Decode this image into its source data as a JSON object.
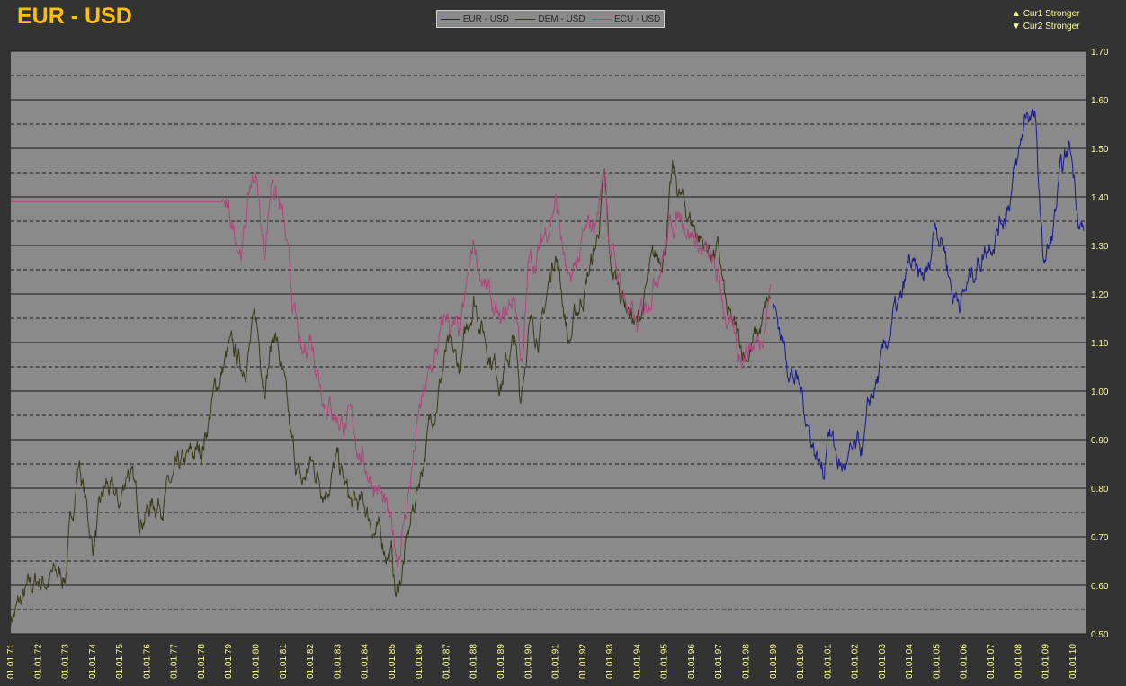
{
  "title": "EUR - USD",
  "legend": [
    {
      "label": "EUR - USD",
      "color": "#1a1a8c"
    },
    {
      "label": "DEM - USD",
      "color": "#3a3a1a"
    },
    {
      "label": "ECU - USD",
      "color": "#b0457a"
    }
  ],
  "strength_legend": {
    "up_symbol": "▲",
    "up_label": "Cur1 Stronger",
    "down_symbol": "▼",
    "down_label": "Cur2 Stronger"
  },
  "chart_data": {
    "type": "line",
    "title": "EUR - USD",
    "ylim": [
      0.5,
      1.7
    ],
    "y_ticks": [
      "0.50",
      "0.60",
      "0.70",
      "0.80",
      "0.90",
      "1.00",
      "1.10",
      "1.20",
      "1.30",
      "1.40",
      "1.50",
      "1.60",
      "1.70"
    ],
    "x_range": [
      1971,
      2010.5
    ],
    "x_ticks": [
      "01.01.71",
      "01.01.72",
      "01.01.73",
      "01.01.74",
      "01.01.75",
      "01.01.76",
      "01.01.77",
      "01.01.78",
      "01.01.79",
      "01.01.80",
      "01.01.81",
      "01.01.82",
      "01.01.83",
      "01.01.84",
      "01.01.85",
      "01.01.86",
      "01.01.87",
      "01.01.88",
      "01.01.89",
      "01.01.90",
      "01.01.91",
      "01.01.92",
      "01.01.93",
      "01.01.94",
      "01.01.95",
      "01.01.96",
      "01.01.97",
      "01.01.98",
      "01.01.99",
      "01.01.00",
      "01.01.01",
      "01.01.02",
      "01.01.03",
      "01.01.04",
      "01.01.05",
      "01.01.06",
      "01.01.07",
      "01.01.08",
      "01.01.09",
      "01.01.10"
    ],
    "grid": "horizontal solid major, dashed minor",
    "series": [
      {
        "name": "DEM - USD",
        "color": "#3a3a1a",
        "points": [
          [
            1971.0,
            0.535
          ],
          [
            1971.5,
            0.57
          ],
          [
            1972.0,
            0.61
          ],
          [
            1972.5,
            0.615
          ],
          [
            1973.0,
            0.625
          ],
          [
            1973.2,
            0.72
          ],
          [
            1973.5,
            0.86
          ],
          [
            1974.0,
            0.68
          ],
          [
            1974.5,
            0.8
          ],
          [
            1975.0,
            0.76
          ],
          [
            1975.3,
            0.85
          ],
          [
            1975.7,
            0.75
          ],
          [
            1976.0,
            0.76
          ],
          [
            1976.5,
            0.78
          ],
          [
            1977.0,
            0.81
          ],
          [
            1977.5,
            0.85
          ],
          [
            1978.0,
            0.88
          ],
          [
            1978.5,
            1.0
          ],
          [
            1979.0,
            1.08
          ],
          [
            1979.5,
            1.05
          ],
          [
            1980.0,
            1.14
          ],
          [
            1980.3,
            1.03
          ],
          [
            1980.7,
            1.13
          ],
          [
            1981.0,
            1.02
          ],
          [
            1981.3,
            0.88
          ],
          [
            1981.7,
            0.8
          ],
          [
            1982.0,
            0.85
          ],
          [
            1982.5,
            0.81
          ],
          [
            1983.0,
            0.85
          ],
          [
            1983.5,
            0.76
          ],
          [
            1984.0,
            0.76
          ],
          [
            1984.5,
            0.7
          ],
          [
            1985.0,
            0.66
          ],
          [
            1985.15,
            0.57
          ],
          [
            1985.5,
            0.67
          ],
          [
            1986.0,
            0.82
          ],
          [
            1986.5,
            0.96
          ],
          [
            1987.0,
            1.08
          ],
          [
            1987.5,
            1.04
          ],
          [
            1988.0,
            1.2
          ],
          [
            1988.5,
            1.1
          ],
          [
            1989.0,
            1.03
          ],
          [
            1989.5,
            1.1
          ],
          [
            1989.7,
            0.98
          ],
          [
            1990.0,
            1.13
          ],
          [
            1990.5,
            1.13
          ],
          [
            1991.0,
            1.3
          ],
          [
            1991.5,
            1.1
          ],
          [
            1992.0,
            1.2
          ],
          [
            1992.5,
            1.3
          ],
          [
            1992.8,
            1.43
          ],
          [
            1993.0,
            1.25
          ],
          [
            1993.5,
            1.2
          ],
          [
            1994.0,
            1.13
          ],
          [
            1994.5,
            1.24
          ],
          [
            1995.0,
            1.3
          ],
          [
            1995.3,
            1.44
          ],
          [
            1995.7,
            1.38
          ],
          [
            1996.0,
            1.35
          ],
          [
            1996.5,
            1.3
          ],
          [
            1997.0,
            1.28
          ],
          [
            1997.3,
            1.15
          ],
          [
            1997.7,
            1.1
          ],
          [
            1998.0,
            1.08
          ],
          [
            1998.5,
            1.12
          ],
          [
            1998.9,
            1.19
          ]
        ]
      },
      {
        "name": "ECU - USD",
        "color": "#b0457a",
        "points": [
          [
            1971.0,
            1.39
          ],
          [
            1978.8,
            1.39
          ],
          [
            1979.0,
            1.35
          ],
          [
            1979.5,
            1.3
          ],
          [
            1979.8,
            1.42
          ],
          [
            1980.0,
            1.45
          ],
          [
            1980.3,
            1.28
          ],
          [
            1980.6,
            1.45
          ],
          [
            1981.0,
            1.35
          ],
          [
            1981.3,
            1.2
          ],
          [
            1981.7,
            1.05
          ],
          [
            1982.0,
            1.12
          ],
          [
            1982.5,
            1.0
          ],
          [
            1983.0,
            0.95
          ],
          [
            1983.5,
            0.93
          ],
          [
            1984.0,
            0.85
          ],
          [
            1984.5,
            0.8
          ],
          [
            1985.0,
            0.7
          ],
          [
            1985.2,
            0.66
          ],
          [
            1985.5,
            0.75
          ],
          [
            1986.0,
            0.95
          ],
          [
            1986.5,
            1.05
          ],
          [
            1987.0,
            1.15
          ],
          [
            1987.5,
            1.1
          ],
          [
            1988.0,
            1.3
          ],
          [
            1988.5,
            1.2
          ],
          [
            1989.0,
            1.12
          ],
          [
            1989.5,
            1.2
          ],
          [
            1989.8,
            1.05
          ],
          [
            1990.0,
            1.25
          ],
          [
            1990.5,
            1.3
          ],
          [
            1991.0,
            1.4
          ],
          [
            1991.5,
            1.2
          ],
          [
            1992.0,
            1.3
          ],
          [
            1992.5,
            1.35
          ],
          [
            1992.8,
            1.46
          ],
          [
            1993.0,
            1.3
          ],
          [
            1993.5,
            1.2
          ],
          [
            1994.0,
            1.12
          ],
          [
            1994.5,
            1.22
          ],
          [
            1995.0,
            1.3
          ],
          [
            1995.3,
            1.35
          ],
          [
            1995.7,
            1.37
          ],
          [
            1996.0,
            1.33
          ],
          [
            1996.5,
            1.28
          ],
          [
            1997.0,
            1.22
          ],
          [
            1997.3,
            1.15
          ],
          [
            1997.7,
            1.07
          ],
          [
            1998.0,
            1.1
          ],
          [
            1998.5,
            1.1
          ],
          [
            1998.9,
            1.22
          ]
        ]
      },
      {
        "name": "EUR - USD",
        "color": "#1a1a8c",
        "points": [
          [
            1999.0,
            1.18
          ],
          [
            1999.5,
            1.07
          ],
          [
            2000.0,
            1.0
          ],
          [
            2000.3,
            0.93
          ],
          [
            2000.6,
            0.87
          ],
          [
            2000.85,
            0.83
          ],
          [
            2001.0,
            0.94
          ],
          [
            2001.3,
            0.87
          ],
          [
            2001.5,
            0.84
          ],
          [
            2002.0,
            0.86
          ],
          [
            2002.3,
            0.88
          ],
          [
            2002.6,
            0.98
          ],
          [
            2003.0,
            1.05
          ],
          [
            2003.4,
            1.15
          ],
          [
            2003.7,
            1.17
          ],
          [
            2004.0,
            1.26
          ],
          [
            2004.3,
            1.22
          ],
          [
            2004.7,
            1.24
          ],
          [
            2004.95,
            1.36
          ],
          [
            2005.3,
            1.3
          ],
          [
            2005.6,
            1.2
          ],
          [
            2006.0,
            1.2
          ],
          [
            2006.5,
            1.27
          ],
          [
            2007.0,
            1.32
          ],
          [
            2007.5,
            1.37
          ],
          [
            2008.0,
            1.47
          ],
          [
            2008.3,
            1.58
          ],
          [
            2008.6,
            1.56
          ],
          [
            2008.9,
            1.27
          ],
          [
            2009.2,
            1.3
          ],
          [
            2009.5,
            1.42
          ],
          [
            2009.9,
            1.5
          ],
          [
            2010.2,
            1.38
          ],
          [
            2010.4,
            1.33
          ]
        ]
      }
    ]
  }
}
